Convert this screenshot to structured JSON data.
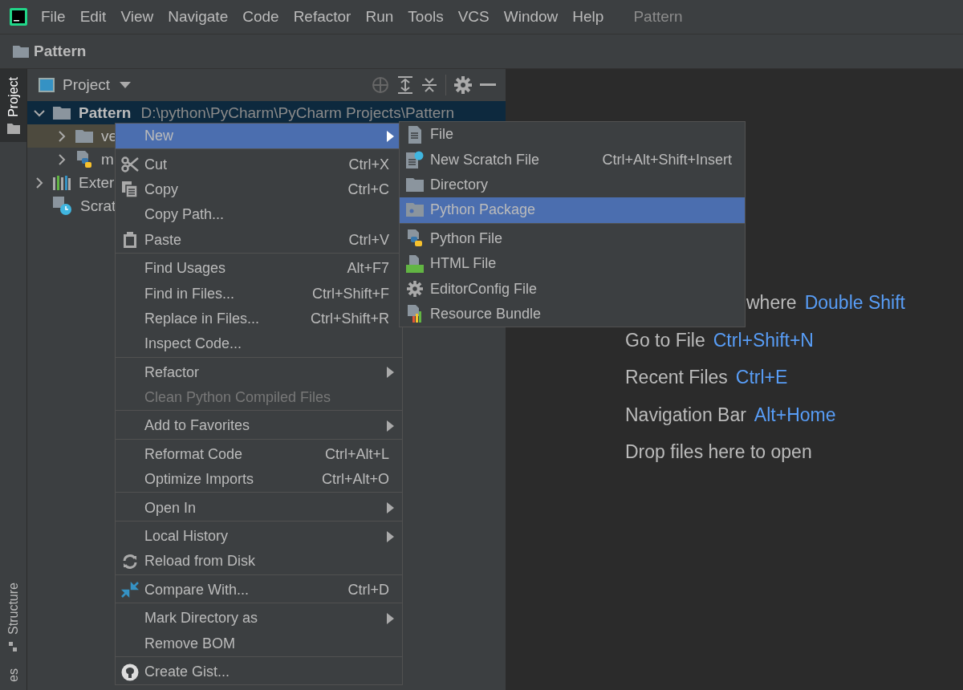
{
  "menu_bar": {
    "items": [
      "File",
      "Edit",
      "View",
      "Navigate",
      "Code",
      "Refactor",
      "Run",
      "Tools",
      "VCS",
      "Window",
      "Help"
    ],
    "title": "Pattern"
  },
  "nav_bar": {
    "label": "Pattern"
  },
  "tool_strip": {
    "top": [
      {
        "label": "Project",
        "selected": true
      }
    ],
    "bottom": [
      {
        "label": "Structure",
        "selected": false
      },
      {
        "label": "es",
        "selected": false
      }
    ]
  },
  "project_panel": {
    "title": "Project"
  },
  "tree": [
    {
      "kind": "folder",
      "label": "Pattern",
      "path": "D:\\python\\PyCharm\\PyCharm Projects\\Pattern",
      "selected": true,
      "excluded": false,
      "expanded": true,
      "children": [
        {
          "kind": "folder",
          "label": "ve",
          "selected": false,
          "excluded": true,
          "expanded": false
        },
        {
          "kind": "python",
          "label": "m",
          "selected": false,
          "excluded": false,
          "expanded": false
        }
      ]
    },
    {
      "kind": "library",
      "label": "Exter",
      "selected": false,
      "excluded": false,
      "expanded": false
    },
    {
      "kind": "scratches",
      "label": "Scrat",
      "selected": false,
      "excluded": false
    }
  ],
  "context_menu": [
    [
      {
        "kind": "plain",
        "label": "New",
        "selected": true,
        "submenu": true
      }
    ],
    [
      {
        "kind": "cut",
        "label": "Cut",
        "shortcut": "Ctrl+X",
        "selected": false
      },
      {
        "kind": "copy",
        "label": "Copy",
        "shortcut": "Ctrl+C",
        "selected": false
      },
      {
        "kind": "plain",
        "label": "Copy Path...",
        "selected": false
      },
      {
        "kind": "paste",
        "label": "Paste",
        "shortcut": "Ctrl+V",
        "selected": false
      }
    ],
    [
      {
        "kind": "plain",
        "label": "Find Usages",
        "shortcut": "Alt+F7",
        "selected": false
      },
      {
        "kind": "plain",
        "label": "Find in Files...",
        "shortcut": "Ctrl+Shift+F",
        "selected": false
      },
      {
        "kind": "plain",
        "label": "Replace in Files...",
        "shortcut": "Ctrl+Shift+R",
        "selected": false
      },
      {
        "kind": "plain",
        "label": "Inspect Code...",
        "selected": false
      }
    ],
    [
      {
        "kind": "plain",
        "label": "Refactor",
        "selected": false,
        "submenu": true
      },
      {
        "kind": "plain",
        "label": "Clean Python Compiled Files",
        "selected": false,
        "disabled": true
      }
    ],
    [
      {
        "kind": "plain",
        "label": "Add to Favorites",
        "selected": false,
        "submenu": true
      }
    ],
    [
      {
        "kind": "plain",
        "label": "Reformat Code",
        "shortcut": "Ctrl+Alt+L",
        "selected": false
      },
      {
        "kind": "plain",
        "label": "Optimize Imports",
        "shortcut": "Ctrl+Alt+O",
        "selected": false
      }
    ],
    [
      {
        "kind": "plain",
        "label": "Open In",
        "selected": false,
        "submenu": true
      }
    ],
    [
      {
        "kind": "plain",
        "label": "Local History",
        "selected": false,
        "submenu": true
      },
      {
        "kind": "reload",
        "label": "Reload from Disk",
        "selected": false
      }
    ],
    [
      {
        "kind": "compare",
        "label": "Compare With...",
        "shortcut": "Ctrl+D",
        "selected": false
      }
    ],
    [
      {
        "kind": "plain",
        "label": "Mark Directory as",
        "selected": false,
        "submenu": true
      },
      {
        "kind": "plain",
        "label": "Remove BOM",
        "selected": false
      }
    ],
    [
      {
        "kind": "github",
        "label": "Create Gist...",
        "selected": false
      }
    ]
  ],
  "new_submenu": [
    [
      {
        "kind": "file",
        "label": "File",
        "selected": false
      },
      {
        "kind": "scratch",
        "label": "New Scratch File",
        "shortcut": "Ctrl+Alt+Shift+Insert",
        "selected": false
      },
      {
        "kind": "folder",
        "label": "Directory",
        "selected": false
      },
      {
        "kind": "package",
        "label": "Python Package",
        "selected": true
      }
    ],
    [
      {
        "kind": "python",
        "label": "Python File",
        "selected": false
      },
      {
        "kind": "html",
        "label": "HTML File",
        "selected": false
      },
      {
        "kind": "gear",
        "label": "EditorConfig File",
        "selected": false
      },
      {
        "kind": "bundle",
        "label": "Resource Bundle",
        "selected": false
      }
    ]
  ],
  "editor_hints": [
    {
      "label": "where",
      "shortcut": "Double Shift"
    },
    {
      "label": "Go to File",
      "shortcut": "Ctrl+Shift+N"
    },
    {
      "label": "Recent Files",
      "shortcut": "Ctrl+E"
    },
    {
      "label": "Navigation Bar",
      "shortcut": "Alt+Home"
    },
    {
      "label": "Drop files here to open"
    }
  ]
}
